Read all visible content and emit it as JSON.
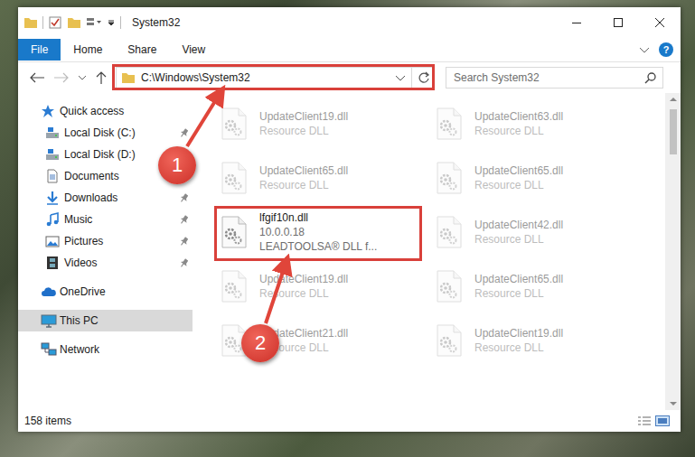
{
  "window": {
    "title": "System32"
  },
  "ribbon": {
    "tabs": [
      {
        "label": "File",
        "kind": "file"
      },
      {
        "label": "Home",
        "kind": "tab"
      },
      {
        "label": "Share",
        "kind": "tab"
      },
      {
        "label": "View",
        "kind": "tab"
      }
    ],
    "help": "?"
  },
  "address": {
    "path": "C:\\Windows\\System32"
  },
  "search": {
    "placeholder": "Search System32"
  },
  "navigation": [
    {
      "label": "Quick access",
      "kind": "quick",
      "pinned": false,
      "selected": false
    },
    {
      "label": "Local Disk (C:)",
      "kind": "drive",
      "pinned": true,
      "selected": false
    },
    {
      "label": "Local Disk (D:)",
      "kind": "drive",
      "pinned": false,
      "selected": false
    },
    {
      "label": "Documents",
      "kind": "documents",
      "pinned": true,
      "selected": false
    },
    {
      "label": "Downloads",
      "kind": "downloads",
      "pinned": true,
      "selected": false
    },
    {
      "label": "Music",
      "kind": "music",
      "pinned": true,
      "selected": false
    },
    {
      "label": "Pictures",
      "kind": "pictures",
      "pinned": true,
      "selected": false
    },
    {
      "label": "Videos",
      "kind": "videos",
      "pinned": true,
      "selected": false
    },
    {
      "label": "OneDrive",
      "kind": "onedrive",
      "pinned": false,
      "selected": false
    },
    {
      "label": "This PC",
      "kind": "pc",
      "pinned": false,
      "selected": true
    },
    {
      "label": "Network",
      "kind": "network",
      "pinned": false,
      "selected": false
    }
  ],
  "files": [
    {
      "name": "UpdateClient19.dll",
      "details": [
        "Resource DLL"
      ],
      "faded": true,
      "highlighted": false
    },
    {
      "name": "UpdateClient63.dll",
      "details": [
        "Resource DLL"
      ],
      "faded": true,
      "highlighted": false
    },
    {
      "name": "UpdateClient65.dll",
      "details": [
        "Resource DLL"
      ],
      "faded": true,
      "highlighted": false
    },
    {
      "name": "UpdateClient65.dll",
      "details": [
        "Resource DLL"
      ],
      "faded": true,
      "highlighted": false
    },
    {
      "name": "lfgif10n.dll",
      "details": [
        "10.0.0.18",
        "LEADTOOLSA® DLL f..."
      ],
      "faded": false,
      "highlighted": true
    },
    {
      "name": "UpdateClient42.dll",
      "details": [
        "Resource DLL"
      ],
      "faded": true,
      "highlighted": false
    },
    {
      "name": "UpdateClient19.dll",
      "details": [
        "Resource DLL"
      ],
      "faded": true,
      "highlighted": false
    },
    {
      "name": "UpdateClient65.dll",
      "details": [
        "Resource DLL"
      ],
      "faded": true,
      "highlighted": false
    },
    {
      "name": "UpdateClient21.dll",
      "details": [
        "Resource DLL"
      ],
      "faded": true,
      "highlighted": false
    },
    {
      "name": "UpdateClient19.dll",
      "details": [
        "Resource DLL"
      ],
      "faded": true,
      "highlighted": false
    }
  ],
  "status_bar": {
    "count": "158 items"
  },
  "annotations": [
    {
      "label": "1"
    },
    {
      "label": "2"
    }
  ]
}
